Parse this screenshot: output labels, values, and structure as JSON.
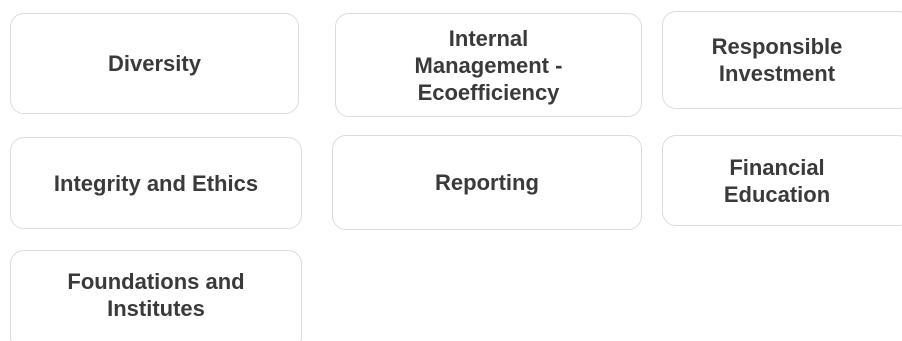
{
  "cards": [
    {
      "label": "Diversity"
    },
    {
      "label": "Internal Management - Ecoefficiency"
    },
    {
      "label": "Responsible Investment"
    },
    {
      "label": "Integrity and Ethics"
    },
    {
      "label": "Reporting"
    },
    {
      "label": "Financial Education"
    },
    {
      "label": "Foundations and Institutes"
    }
  ]
}
